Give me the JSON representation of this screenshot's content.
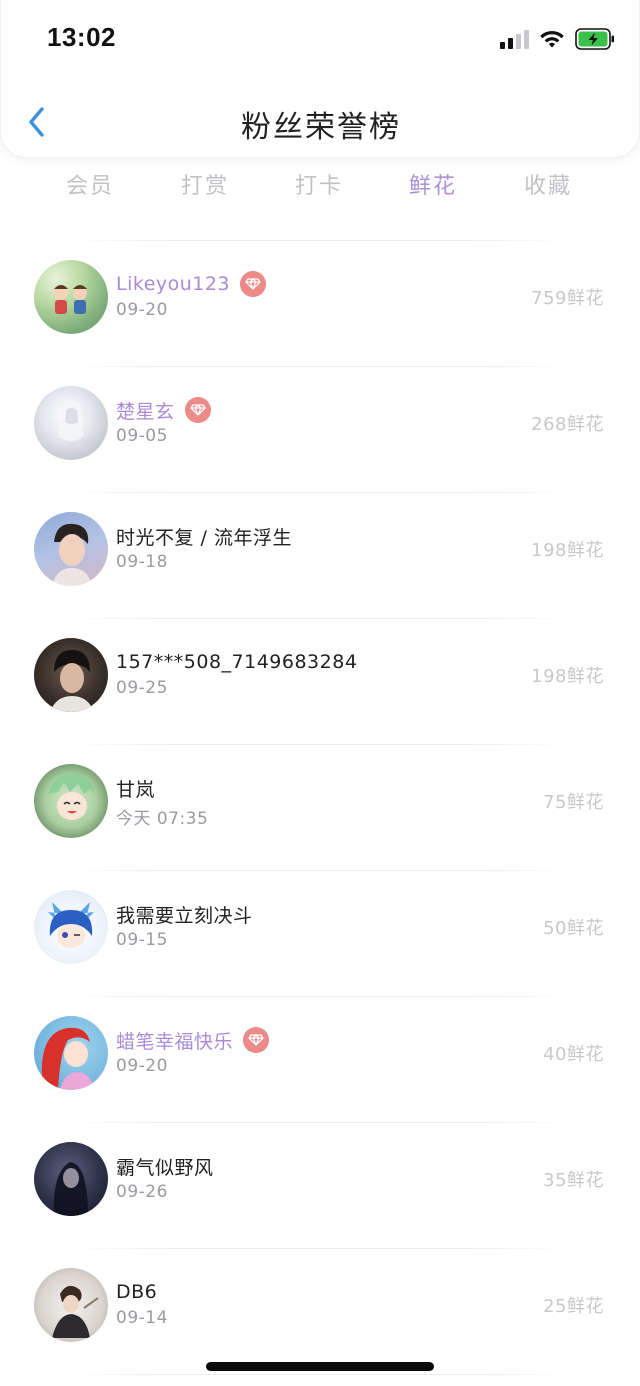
{
  "status_bar": {
    "time": "13:02"
  },
  "header": {
    "title": "粉丝荣誉榜"
  },
  "tabs": [
    {
      "label": "会员",
      "active": false
    },
    {
      "label": "打赏",
      "active": false
    },
    {
      "label": "打卡",
      "active": false
    },
    {
      "label": "鲜花",
      "active": true
    },
    {
      "label": "收藏",
      "active": false
    }
  ],
  "list": [
    {
      "name": "Likeyou123",
      "vip": true,
      "date": "09-20",
      "score": "759鲜花"
    },
    {
      "name": "楚星玄",
      "vip": true,
      "date": "09-05",
      "score": "268鲜花"
    },
    {
      "name": "时光不复 / 流年浮生",
      "vip": false,
      "date": "09-18",
      "score": "198鲜花"
    },
    {
      "name": "157***508_7149683284",
      "vip": false,
      "date": "09-25",
      "score": "198鲜花"
    },
    {
      "name": "甘岚",
      "vip": false,
      "date": "今天 07:35",
      "score": "75鲜花"
    },
    {
      "name": "我需要立刻决斗",
      "vip": false,
      "date": "09-15",
      "score": "50鲜花"
    },
    {
      "name": "蜡笔幸福快乐",
      "vip": true,
      "date": "09-20",
      "score": "40鲜花"
    },
    {
      "name": "霸气似野风",
      "vip": false,
      "date": "09-26",
      "score": "35鲜花"
    },
    {
      "name": "DB6",
      "vip": false,
      "date": "09-14",
      "score": "25鲜花"
    }
  ],
  "colors": {
    "accent": "#b08fd8",
    "vip_name": "#a98bd6",
    "vip_badge": "#ec8a87",
    "inactive_tab": "#c2c2c6",
    "score": "#c8c8cc",
    "back_icon": "#3d8fe0",
    "battery": "#3bc14a"
  },
  "icons": {
    "back": "chevron-left-icon",
    "vip": "diamond-icon",
    "signal": "cellular-signal-icon",
    "wifi": "wifi-icon",
    "battery": "battery-charging-icon"
  }
}
